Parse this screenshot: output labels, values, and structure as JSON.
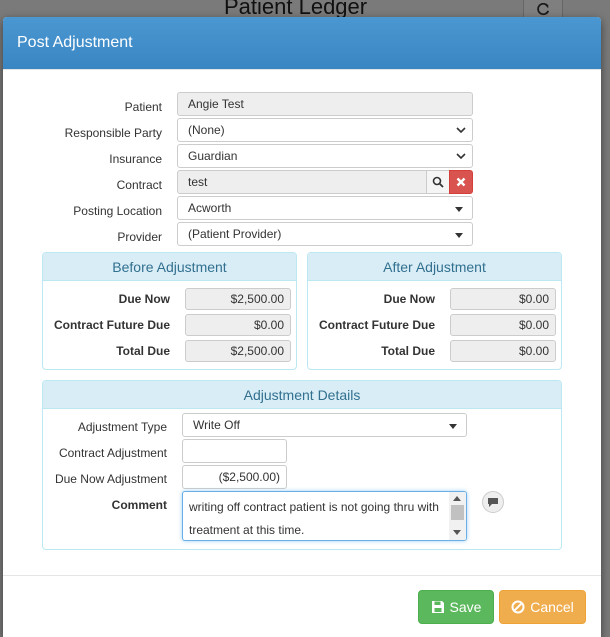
{
  "background": {
    "title": "Patient Ledger"
  },
  "modal": {
    "title": "Post Adjustment",
    "fields": {
      "patient": {
        "label": "Patient",
        "value": "Angie Test"
      },
      "responsible_party": {
        "label": "Responsible Party",
        "value": "(None)"
      },
      "insurance": {
        "label": "Insurance",
        "value": "Guardian"
      },
      "contract": {
        "label": "Contract",
        "value": "test"
      },
      "posting_location": {
        "label": "Posting Location",
        "value": "Acworth"
      },
      "provider": {
        "label": "Provider",
        "value": "(Patient Provider)"
      }
    },
    "before": {
      "heading": "Before Adjustment",
      "due_now": {
        "label": "Due Now",
        "value": "$2,500.00"
      },
      "contract_future_due": {
        "label": "Contract Future Due",
        "value": "$0.00"
      },
      "total_due": {
        "label": "Total Due",
        "value": "$2,500.00"
      }
    },
    "after": {
      "heading": "After Adjustment",
      "due_now": {
        "label": "Due Now",
        "value": "$0.00"
      },
      "contract_future_due": {
        "label": "Contract Future Due",
        "value": "$0.00"
      },
      "total_due": {
        "label": "Total Due",
        "value": "$0.00"
      }
    },
    "details": {
      "heading": "Adjustment Details",
      "adjustment_type": {
        "label": "Adjustment Type",
        "value": "Write Off"
      },
      "contract_adjustment": {
        "label": "Contract Adjustment",
        "value": ""
      },
      "due_now_adjustment": {
        "label": "Due Now Adjustment",
        "value": "($2,500.00)"
      },
      "comment": {
        "label": "Comment",
        "value": "writing off contract patient is not going thru with treatment at this time."
      }
    },
    "footer": {
      "save_label": "Save",
      "cancel_label": "Cancel"
    }
  },
  "colors": {
    "header": "#3a86c3",
    "save": "#5cb85c",
    "cancel": "#f0ad4e",
    "panel_heading": "#d9edf7"
  }
}
